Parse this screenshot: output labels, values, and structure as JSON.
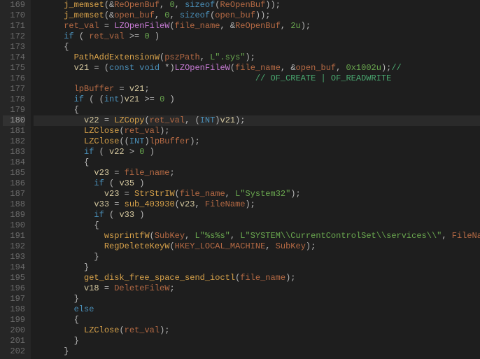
{
  "lines": [
    {
      "n": 169,
      "indent": 3,
      "tokens": [
        {
          "t": "fn",
          "v": "j_memset"
        },
        {
          "t": "op",
          "v": "("
        },
        {
          "t": "amp",
          "v": "&"
        },
        {
          "t": "glb",
          "v": "ReOpenBuf"
        },
        {
          "t": "op",
          "v": ", "
        },
        {
          "t": "num",
          "v": "0"
        },
        {
          "t": "op",
          "v": ", "
        },
        {
          "t": "kw",
          "v": "sizeof"
        },
        {
          "t": "op",
          "v": "("
        },
        {
          "t": "glb",
          "v": "ReOpenBuf"
        },
        {
          "t": "op",
          "v": "));"
        }
      ]
    },
    {
      "n": 170,
      "indent": 3,
      "tokens": [
        {
          "t": "fn",
          "v": "j_memset"
        },
        {
          "t": "op",
          "v": "("
        },
        {
          "t": "amp",
          "v": "&"
        },
        {
          "t": "glb",
          "v": "open_buf"
        },
        {
          "t": "op",
          "v": ", "
        },
        {
          "t": "num",
          "v": "0"
        },
        {
          "t": "op",
          "v": ", "
        },
        {
          "t": "kw",
          "v": "sizeof"
        },
        {
          "t": "op",
          "v": "("
        },
        {
          "t": "glb",
          "v": "open_buf"
        },
        {
          "t": "op",
          "v": "));"
        }
      ]
    },
    {
      "n": 171,
      "indent": 3,
      "tokens": [
        {
          "t": "glb",
          "v": "ret_val"
        },
        {
          "t": "op",
          "v": " = "
        },
        {
          "t": "lib",
          "v": "LZOpenFileW"
        },
        {
          "t": "op",
          "v": "("
        },
        {
          "t": "glb",
          "v": "file_name"
        },
        {
          "t": "op",
          "v": ", "
        },
        {
          "t": "amp",
          "v": "&"
        },
        {
          "t": "glb",
          "v": "ReOpenBuf"
        },
        {
          "t": "op",
          "v": ", "
        },
        {
          "t": "num",
          "v": "2u"
        },
        {
          "t": "op",
          "v": ");"
        }
      ]
    },
    {
      "n": 172,
      "indent": 3,
      "tokens": [
        {
          "t": "kw",
          "v": "if"
        },
        {
          "t": "op",
          "v": " ( "
        },
        {
          "t": "glb",
          "v": "ret_val"
        },
        {
          "t": "op",
          "v": " >= "
        },
        {
          "t": "num",
          "v": "0"
        },
        {
          "t": "op",
          "v": " )"
        }
      ]
    },
    {
      "n": 173,
      "indent": 3,
      "tokens": [
        {
          "t": "op",
          "v": "{"
        }
      ]
    },
    {
      "n": 174,
      "indent": 4,
      "tokens": [
        {
          "t": "fn",
          "v": "PathAddExtensionW"
        },
        {
          "t": "op",
          "v": "("
        },
        {
          "t": "glb",
          "v": "pszPath"
        },
        {
          "t": "op",
          "v": ", "
        },
        {
          "t": "str",
          "v": "L\".sys\""
        },
        {
          "t": "op",
          "v": ");"
        }
      ]
    },
    {
      "n": 175,
      "indent": 4,
      "tokens": [
        {
          "t": "pl",
          "v": "v21"
        },
        {
          "t": "op",
          "v": " = ("
        },
        {
          "t": "kw",
          "v": "const"
        },
        {
          "t": "op",
          "v": " "
        },
        {
          "t": "kw",
          "v": "void"
        },
        {
          "t": "op",
          "v": " *)"
        },
        {
          "t": "lib",
          "v": "LZOpenFileW"
        },
        {
          "t": "op",
          "v": "("
        },
        {
          "t": "glb",
          "v": "file_name"
        },
        {
          "t": "op",
          "v": ", "
        },
        {
          "t": "amp",
          "v": "&"
        },
        {
          "t": "glb",
          "v": "open_buf"
        },
        {
          "t": "op",
          "v": ", "
        },
        {
          "t": "num",
          "v": "0x1002u"
        },
        {
          "t": "op",
          "v": ");"
        },
        {
          "t": "cmt",
          "v": "//"
        }
      ]
    },
    {
      "n": 176,
      "indent": 4,
      "tokens": [
        {
          "t": "pl",
          "v": "                                    "
        },
        {
          "t": "cmt",
          "v": "// OF_CREATE | OF_READWRITE"
        }
      ]
    },
    {
      "n": 177,
      "indent": 4,
      "tokens": [
        {
          "t": "glb",
          "v": "lpBuffer"
        },
        {
          "t": "op",
          "v": " = "
        },
        {
          "t": "pl",
          "v": "v21"
        },
        {
          "t": "op",
          "v": ";"
        }
      ]
    },
    {
      "n": 178,
      "indent": 4,
      "tokens": [
        {
          "t": "kw",
          "v": "if"
        },
        {
          "t": "op",
          "v": " ( ("
        },
        {
          "t": "typ",
          "v": "int"
        },
        {
          "t": "op",
          "v": ")"
        },
        {
          "t": "pl",
          "v": "v21"
        },
        {
          "t": "op",
          "v": " >= "
        },
        {
          "t": "num",
          "v": "0"
        },
        {
          "t": "op",
          "v": " )"
        }
      ]
    },
    {
      "n": 179,
      "indent": 4,
      "tokens": [
        {
          "t": "op",
          "v": "{"
        }
      ]
    },
    {
      "n": 180,
      "indent": 5,
      "hl": true,
      "tokens": [
        {
          "t": "pl",
          "v": "v22"
        },
        {
          "t": "op",
          "v": " = "
        },
        {
          "t": "fn",
          "v": "LZCopy"
        },
        {
          "t": "op",
          "v": "("
        },
        {
          "t": "glb",
          "v": "ret_val"
        },
        {
          "t": "op",
          "v": ", ("
        },
        {
          "t": "typ",
          "v": "INT"
        },
        {
          "t": "op",
          "v": ")"
        },
        {
          "t": "pl",
          "v": "v21"
        },
        {
          "t": "op",
          "v": ");"
        }
      ]
    },
    {
      "n": 181,
      "indent": 5,
      "tokens": [
        {
          "t": "fn",
          "v": "LZClose"
        },
        {
          "t": "op",
          "v": "("
        },
        {
          "t": "glb",
          "v": "ret_val"
        },
        {
          "t": "op",
          "v": ");"
        }
      ]
    },
    {
      "n": 182,
      "indent": 5,
      "tokens": [
        {
          "t": "fn",
          "v": "LZClose"
        },
        {
          "t": "op",
          "v": "(("
        },
        {
          "t": "typ",
          "v": "INT"
        },
        {
          "t": "op",
          "v": ")"
        },
        {
          "t": "glb",
          "v": "lpBuffer"
        },
        {
          "t": "op",
          "v": ");"
        }
      ]
    },
    {
      "n": 183,
      "indent": 5,
      "tokens": [
        {
          "t": "kw",
          "v": "if"
        },
        {
          "t": "op",
          "v": " ( "
        },
        {
          "t": "pl",
          "v": "v22"
        },
        {
          "t": "op",
          "v": " > "
        },
        {
          "t": "num",
          "v": "0"
        },
        {
          "t": "op",
          "v": " )"
        }
      ]
    },
    {
      "n": 184,
      "indent": 5,
      "tokens": [
        {
          "t": "op",
          "v": "{"
        }
      ]
    },
    {
      "n": 185,
      "indent": 6,
      "tokens": [
        {
          "t": "pl",
          "v": "v23"
        },
        {
          "t": "op",
          "v": " = "
        },
        {
          "t": "glb",
          "v": "file_name"
        },
        {
          "t": "op",
          "v": ";"
        }
      ]
    },
    {
      "n": 186,
      "indent": 6,
      "tokens": [
        {
          "t": "kw",
          "v": "if"
        },
        {
          "t": "op",
          "v": " ( "
        },
        {
          "t": "pl",
          "v": "v35"
        },
        {
          "t": "op",
          "v": " )"
        }
      ]
    },
    {
      "n": 187,
      "indent": 7,
      "tokens": [
        {
          "t": "pl",
          "v": "v23"
        },
        {
          "t": "op",
          "v": " = "
        },
        {
          "t": "fn",
          "v": "StrStrIW"
        },
        {
          "t": "op",
          "v": "("
        },
        {
          "t": "glb",
          "v": "file_name"
        },
        {
          "t": "op",
          "v": ", "
        },
        {
          "t": "str",
          "v": "L\"System32\""
        },
        {
          "t": "op",
          "v": ");"
        }
      ]
    },
    {
      "n": 188,
      "indent": 6,
      "tokens": [
        {
          "t": "pl",
          "v": "v33"
        },
        {
          "t": "op",
          "v": " = "
        },
        {
          "t": "fn",
          "v": "sub_403930"
        },
        {
          "t": "op",
          "v": "("
        },
        {
          "t": "pl",
          "v": "v23"
        },
        {
          "t": "op",
          "v": ", "
        },
        {
          "t": "glb",
          "v": "FileName"
        },
        {
          "t": "op",
          "v": ");"
        }
      ]
    },
    {
      "n": 189,
      "indent": 6,
      "tokens": [
        {
          "t": "kw",
          "v": "if"
        },
        {
          "t": "op",
          "v": " ( "
        },
        {
          "t": "pl",
          "v": "v33"
        },
        {
          "t": "op",
          "v": " )"
        }
      ]
    },
    {
      "n": 190,
      "indent": 6,
      "tokens": [
        {
          "t": "op",
          "v": "{"
        }
      ]
    },
    {
      "n": 191,
      "indent": 7,
      "tokens": [
        {
          "t": "fn",
          "v": "wsprintfW"
        },
        {
          "t": "op",
          "v": "("
        },
        {
          "t": "glb",
          "v": "SubKey"
        },
        {
          "t": "op",
          "v": ", "
        },
        {
          "t": "str",
          "v": "L\"%s%s\""
        },
        {
          "t": "op",
          "v": ", "
        },
        {
          "t": "str",
          "v": "L\"SYSTEM\\\\CurrentControlSet\\\\services\\\\\""
        },
        {
          "t": "op",
          "v": ", "
        },
        {
          "t": "glb",
          "v": "FileName"
        },
        {
          "t": "op",
          "v": ");"
        }
      ]
    },
    {
      "n": 192,
      "indent": 7,
      "tokens": [
        {
          "t": "fn",
          "v": "RegDeleteKeyW"
        },
        {
          "t": "op",
          "v": "("
        },
        {
          "t": "glb",
          "v": "HKEY_LOCAL_MACHINE"
        },
        {
          "t": "op",
          "v": ", "
        },
        {
          "t": "glb",
          "v": "SubKey"
        },
        {
          "t": "op",
          "v": ");"
        }
      ]
    },
    {
      "n": 193,
      "indent": 6,
      "tokens": [
        {
          "t": "op",
          "v": "}"
        }
      ]
    },
    {
      "n": 194,
      "indent": 5,
      "tokens": [
        {
          "t": "op",
          "v": "}"
        }
      ]
    },
    {
      "n": 195,
      "indent": 5,
      "tokens": [
        {
          "t": "fn",
          "v": "get_disk_free_space_send_ioctl"
        },
        {
          "t": "op",
          "v": "("
        },
        {
          "t": "glb",
          "v": "file_name"
        },
        {
          "t": "op",
          "v": ");"
        }
      ]
    },
    {
      "n": 196,
      "indent": 5,
      "tokens": [
        {
          "t": "pl",
          "v": "v18"
        },
        {
          "t": "op",
          "v": " = "
        },
        {
          "t": "glb",
          "v": "DeleteFileW"
        },
        {
          "t": "op",
          "v": ";"
        }
      ]
    },
    {
      "n": 197,
      "indent": 4,
      "tokens": [
        {
          "t": "op",
          "v": "}"
        }
      ]
    },
    {
      "n": 198,
      "indent": 4,
      "tokens": [
        {
          "t": "kw",
          "v": "else"
        }
      ]
    },
    {
      "n": 199,
      "indent": 4,
      "tokens": [
        {
          "t": "op",
          "v": "{"
        }
      ]
    },
    {
      "n": 200,
      "indent": 5,
      "tokens": [
        {
          "t": "fn",
          "v": "LZClose"
        },
        {
          "t": "op",
          "v": "("
        },
        {
          "t": "glb",
          "v": "ret_val"
        },
        {
          "t": "op",
          "v": ");"
        }
      ]
    },
    {
      "n": 201,
      "indent": 4,
      "tokens": [
        {
          "t": "op",
          "v": "}"
        }
      ]
    },
    {
      "n": 202,
      "indent": 3,
      "tokens": [
        {
          "t": "op",
          "v": "}"
        }
      ]
    }
  ],
  "indent_unit": "  "
}
